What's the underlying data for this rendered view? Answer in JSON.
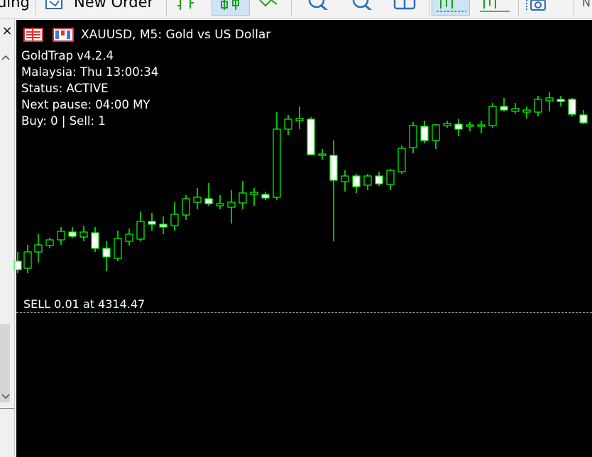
{
  "toolbar": {
    "partial_label_left": "uing",
    "new_order_label": "New Order",
    "right_partial": "N",
    "icons": [
      "new-order-icon",
      "bar-chart-icon",
      "candlestick-chart-icon",
      "line-chart-icon",
      "zoom-in-icon",
      "zoom-out-icon",
      "tile-windows-icon",
      "period-separator-icon",
      "indicators-icon",
      "screenshot-icon"
    ]
  },
  "sidebar": {
    "close_glyph": "×",
    "icons": [
      "close-icon",
      "chevron-up-icon",
      "chevron-down-icon"
    ]
  },
  "chart": {
    "symbol": "XAUUSD",
    "timeframe": "M5",
    "title": "XAUUSD, M5:  Gold vs US Dollar",
    "colors": {
      "background": "#000000",
      "bull_candle": "#000000",
      "bear_candle": "#ffffff",
      "wick": "#00ff00",
      "text": "#ffffff",
      "order_line": "#7fa3a3"
    },
    "info_lines": [
      "GoldTrap v4.2.4",
      "Malaysia: Thu 13:00:34",
      "Status: ACTIVE",
      "Next pause: 04:00 MY",
      "Buy: 0 | Sell: 1"
    ],
    "order_label": "SELL 0.01 at 4314.47",
    "order": {
      "side": "SELL",
      "volume": "0.01",
      "price": "4314.47"
    }
  }
}
